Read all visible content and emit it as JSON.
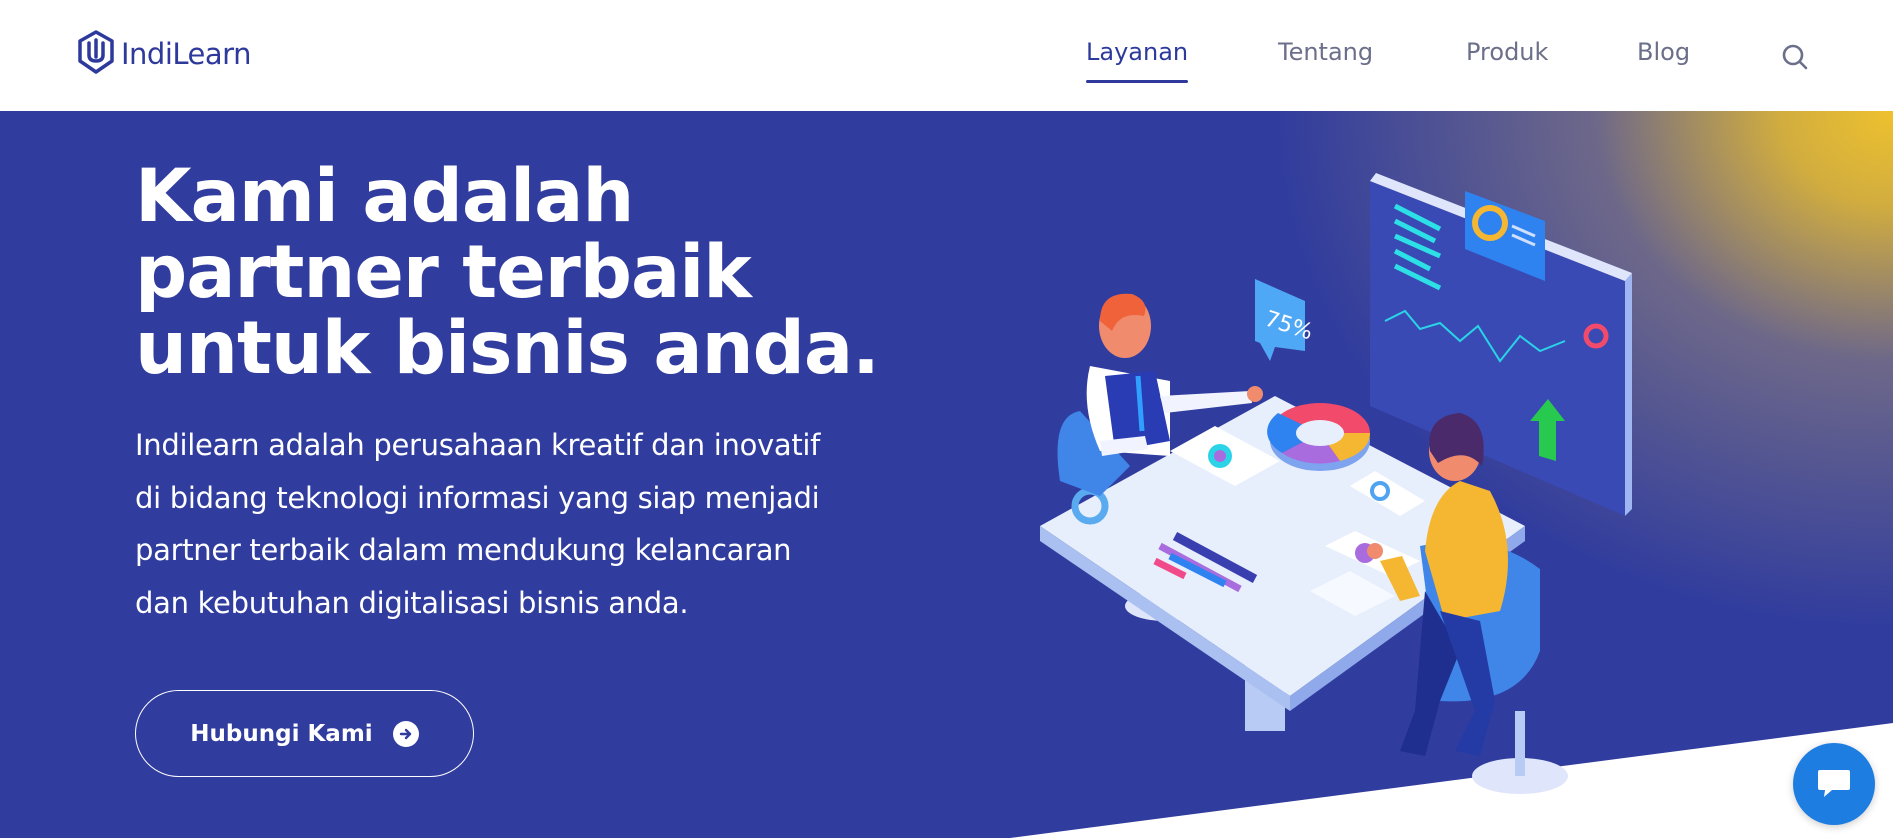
{
  "brand": {
    "name": "IndiLearn",
    "logo_icon": "shield-logo-icon",
    "color": "#2d3a9c"
  },
  "nav": {
    "items": [
      {
        "label": "Layanan",
        "active": true
      },
      {
        "label": "Tentang",
        "active": false
      },
      {
        "label": "Produk",
        "active": false
      },
      {
        "label": "Blog",
        "active": false
      }
    ],
    "search_icon": "search-icon"
  },
  "hero": {
    "title_lines": [
      "Kami adalah",
      "partner terbaik",
      "untuk bisnis anda."
    ],
    "description_lines": [
      "Indilearn adalah perusahaan kreatif dan inovatif",
      "di bidang teknologi informasi yang siap menjadi",
      "partner terbaik dalam mendukung kelancaran",
      "dan kebutuhan digitalisasi bisnis anda."
    ],
    "cta_label": "Hubungi Kami",
    "cta_icon": "arrow-right-circle-icon",
    "background_color": "#303c9e",
    "accent_color": "#eec12e"
  },
  "illustration": {
    "badge_text": "75%"
  },
  "chat": {
    "icon": "chat-bubble-icon",
    "color": "#1d7de0"
  }
}
